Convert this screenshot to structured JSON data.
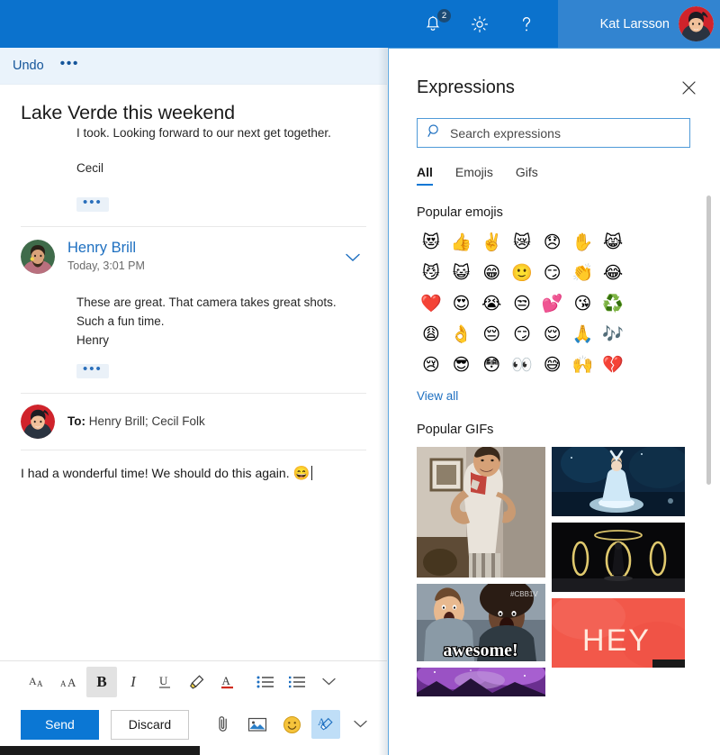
{
  "topbar": {
    "notification_icon": "bell-icon",
    "notification_count": "2",
    "settings_icon": "gear-icon",
    "help_icon": "question-mark-icon",
    "account_name": "Kat Larsson",
    "accent_color": "#0b72cd",
    "accent_color_light": "#3284d0"
  },
  "undobar": {
    "undo_label": "Undo",
    "more_label": "•••"
  },
  "mail": {
    "subject": "Lake Verde this weekend",
    "messages": [
      {
        "body_line1": "I took. Looking forward to our next get together.",
        "body_line2": "Cecil",
        "more_label": "•••"
      },
      {
        "sender": "Henry Brill",
        "time": "Today, 3:01 PM",
        "collapse_icon": "chevron-down-icon",
        "body_line1": "These are great. That camera takes great shots.",
        "body_line2": "Such a fun time.",
        "body_line3": "Henry",
        "more_label": "•••"
      }
    ],
    "compose": {
      "to_label": "To:",
      "to_recipients": "Henry Brill; Cecil Folk",
      "body_text": "I had a wonderful time!  We should do this again.",
      "body_emoji": "😄",
      "more_label": "•••"
    }
  },
  "format_toolbar": {
    "buttons": [
      {
        "name": "decrease-font-size-button",
        "label": "Aᴀ",
        "active": false
      },
      {
        "name": "increase-font-size-button",
        "label": "ᴀA",
        "active": false
      },
      {
        "name": "bold-button",
        "label": "B",
        "active": true
      },
      {
        "name": "italic-button",
        "label": "I",
        "active": false
      },
      {
        "name": "underline-button",
        "label": "U",
        "active": false
      },
      {
        "name": "highlight-button",
        "label": "",
        "active": false
      },
      {
        "name": "font-color-button",
        "label": "A",
        "active": false
      },
      {
        "name": "bulleted-list-button",
        "label": "",
        "active": false
      },
      {
        "name": "numbered-list-button",
        "label": "",
        "active": false
      },
      {
        "name": "more-formatting-button",
        "label": "",
        "active": false
      }
    ]
  },
  "action_bar": {
    "send_label": "Send",
    "discard_label": "Discard",
    "attach_icon": "paperclip-icon",
    "image_icon": "picture-icon",
    "emoji_icon": "smiley-face-icon",
    "expressions_icon": "expressions-icon",
    "more_icon": "chevron-down-icon",
    "send_color": "#0b77d4"
  },
  "expressions": {
    "title": "Expressions",
    "close_icon": "close-icon",
    "search": {
      "icon": "search-icon",
      "placeholder": "Search expressions",
      "value": ""
    },
    "tabs": [
      {
        "label": "All",
        "active": true
      },
      {
        "label": "Emojis",
        "active": false
      },
      {
        "label": "Gifs",
        "active": false
      }
    ],
    "popular_emojis_title": "Popular emojis",
    "popular_emojis": [
      "😻",
      "👍",
      "✌️",
      "😿",
      "😞",
      "✋",
      "😹",
      "😼",
      "😺",
      "😁",
      "🙂",
      "😏",
      "👏",
      "😂",
      "❤️",
      "😍",
      "😭",
      "😒",
      "💕",
      "😘",
      "♻️",
      "😩",
      "👌",
      "😔",
      "😏",
      "😌",
      "🙏",
      "🎶",
      "😢",
      "😎",
      "😳",
      "👀",
      "😅",
      "🙌",
      "💔"
    ],
    "view_all_label": "View all",
    "popular_gifs_title": "Popular GIFs",
    "gifs": [
      {
        "name": "gif-man-dancing",
        "caption": ""
      },
      {
        "name": "gif-awesome-reaction",
        "caption": "awesome!",
        "watermark": "#CBB1V"
      },
      {
        "name": "gif-purple-sky",
        "caption": ""
      },
      {
        "name": "gif-ice-performer",
        "caption": ""
      },
      {
        "name": "gif-rings-stage",
        "caption": ""
      },
      {
        "name": "gif-hey-text",
        "caption": "HEY"
      }
    ]
  }
}
